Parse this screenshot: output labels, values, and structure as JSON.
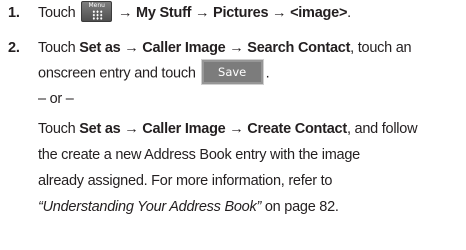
{
  "steps": [
    {
      "number": "1.",
      "touch": "Touch",
      "menu_key_label": "Menu",
      "path": "→ My Stuff → Pictures → <image>",
      "period": "."
    },
    {
      "number": "2.",
      "touch": "Touch",
      "path": "Set as → Caller Image → Search Contact",
      "text_a": ", touch an",
      "text_b": "onscreen entry and touch",
      "save_label": "Save",
      "period": ".",
      "or": "– or –",
      "alt_touch": "Touch",
      "alt_path": "Set as → Caller Image → Create Contact",
      "alt_text_a": ", and follow",
      "alt_text_b": "the create a new Address Book entry with the image",
      "alt_text_c": "already assigned. For more information, refer to",
      "reference": "“Understanding Your Address Book”",
      "page_ref": " on page 82."
    }
  ]
}
